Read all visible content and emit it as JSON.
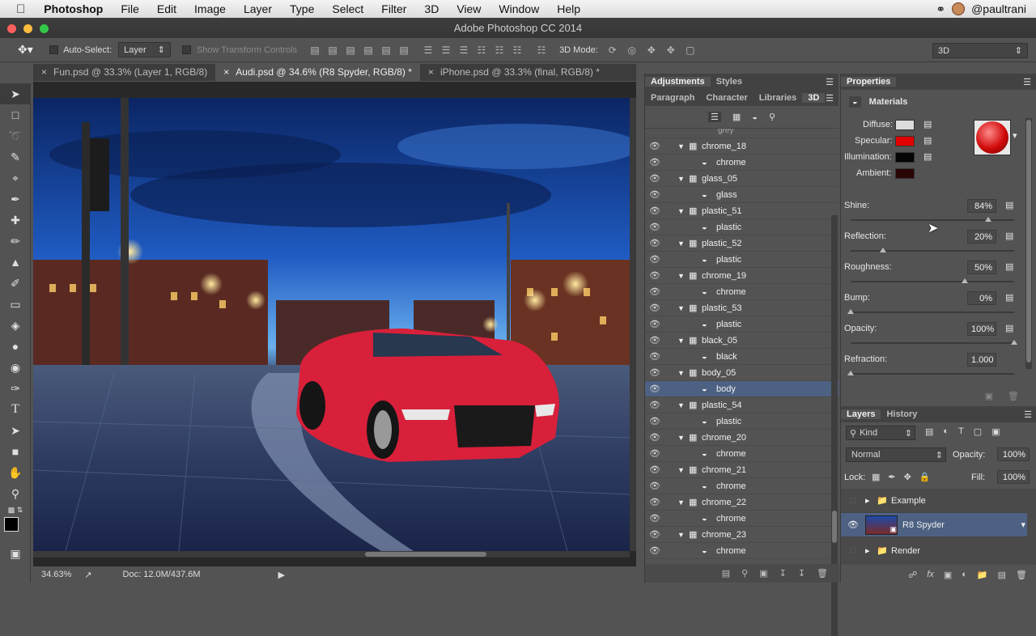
{
  "menubar": {
    "app": "Photoshop",
    "items": [
      "File",
      "Edit",
      "Image",
      "Layer",
      "Type",
      "Select",
      "Filter",
      "3D",
      "View",
      "Window",
      "Help"
    ],
    "user": "@paultrani"
  },
  "window": {
    "title": "Adobe Photoshop CC 2014"
  },
  "options": {
    "auto_select_label": "Auto-Select:",
    "auto_select_value": "Layer",
    "transform_label": "Show Transform Controls",
    "mode3d_label": "3D Mode:",
    "workspace": "3D"
  },
  "doc_tabs": [
    {
      "label": "Fun.psd @ 33.3% (Layer 1, RGB/8)",
      "active": false
    },
    {
      "label": "Audi.psd @ 34.6% (R8 Spyder, RGB/8) *",
      "active": true
    },
    {
      "label": "iPhone.psd @ 33.3% (final, RGB/8) *",
      "active": false
    }
  ],
  "status": {
    "zoom": "34.63%",
    "doc": "Doc: 12.0M/437.6M"
  },
  "midpanel": {
    "tabs_top": [
      "Adjustments",
      "Styles"
    ],
    "tabs_second": [
      "Paragraph",
      "Character",
      "Libraries",
      "3D"
    ],
    "scene_rows": [
      {
        "type": "group",
        "label": "chrome_18"
      },
      {
        "type": "material",
        "label": "chrome"
      },
      {
        "type": "group",
        "label": "glass_05"
      },
      {
        "type": "material",
        "label": "glass"
      },
      {
        "type": "group",
        "label": "plastic_51"
      },
      {
        "type": "material",
        "label": "plastic"
      },
      {
        "type": "group",
        "label": "plastic_52"
      },
      {
        "type": "material",
        "label": "plastic"
      },
      {
        "type": "group",
        "label": "chrome_19"
      },
      {
        "type": "material",
        "label": "chrome"
      },
      {
        "type": "group",
        "label": "plastic_53"
      },
      {
        "type": "material",
        "label": "plastic"
      },
      {
        "type": "group",
        "label": "black_05"
      },
      {
        "type": "material",
        "label": "black"
      },
      {
        "type": "group",
        "label": "body_05"
      },
      {
        "type": "material",
        "label": "body",
        "selected": true
      },
      {
        "type": "group",
        "label": "plastic_54"
      },
      {
        "type": "material",
        "label": "plastic"
      },
      {
        "type": "group",
        "label": "chrome_20"
      },
      {
        "type": "material",
        "label": "chrome"
      },
      {
        "type": "group",
        "label": "chrome_21"
      },
      {
        "type": "material",
        "label": "chrome"
      },
      {
        "type": "group",
        "label": "chrome_22"
      },
      {
        "type": "material",
        "label": "chrome"
      },
      {
        "type": "group",
        "label": "chrome_23"
      },
      {
        "type": "material",
        "label": "chrome"
      }
    ]
  },
  "properties": {
    "tab": "Properties",
    "section": "Materials",
    "diffuse_label": "Diffuse:",
    "specular_label": "Specular:",
    "illumination_label": "Illumination:",
    "ambient_label": "Ambient:",
    "colors": {
      "diffuse": "#dcdcdc",
      "specular": "#e00000",
      "illumination": "#050505",
      "ambient": "#2a0505"
    },
    "sliders": [
      {
        "label": "Shine:",
        "value": "84%",
        "level": 0.84
      },
      {
        "label": "Reflection:",
        "value": "20%",
        "level": 0.2
      },
      {
        "label": "Roughness:",
        "value": "50%",
        "level": 0.7
      },
      {
        "label": "Bump:",
        "value": "0%",
        "level": 0.0
      },
      {
        "label": "Opacity:",
        "value": "100%",
        "level": 1.0
      },
      {
        "label": "Refraction:",
        "value": "1.000",
        "level": 0.0
      }
    ]
  },
  "layers_panel": {
    "tabs": [
      "Layers",
      "History"
    ],
    "kind": "Kind",
    "blend_mode": "Normal",
    "opacity_label": "Opacity:",
    "opacity_value": "100%",
    "lock_label": "Lock:",
    "fill_label": "Fill:",
    "fill_value": "100%",
    "layers": [
      {
        "name": "Example",
        "type": "folder"
      },
      {
        "name": "R8 Spyder",
        "type": "3d",
        "selected": true
      },
      {
        "name": "Render",
        "type": "folder"
      }
    ]
  }
}
